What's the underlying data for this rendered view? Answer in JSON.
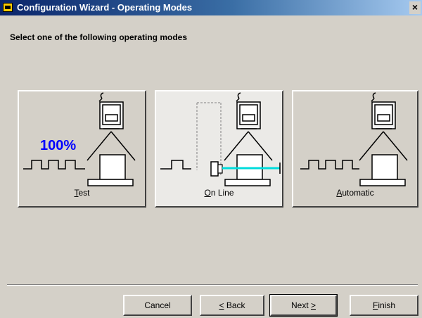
{
  "window": {
    "title": "Configuration Wizard - Operating Modes",
    "close_glyph": "×"
  },
  "instruction": "Select one of the following operating modes",
  "modes": [
    {
      "mnemonic": "T",
      "rest": "est",
      "percent_text": "100%",
      "selected": false
    },
    {
      "mnemonic": "O",
      "rest": "n Line",
      "selected": true
    },
    {
      "mnemonic": "A",
      "rest": "utomatic",
      "selected": false
    }
  ],
  "buttons": {
    "cancel": "Cancel",
    "back_mnemonic": "<",
    "back_rest": " Back",
    "next_text": "Next ",
    "next_mnemonic": ">",
    "finish_mnemonic": "F",
    "finish_rest": "inish"
  },
  "colors": {
    "percent_text": "#0000ff",
    "laser": "#00dcdc"
  }
}
